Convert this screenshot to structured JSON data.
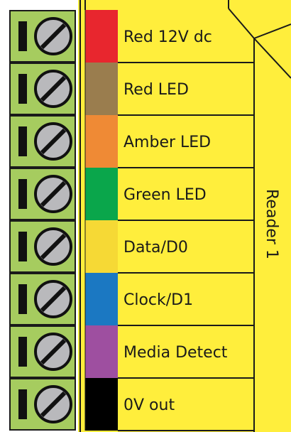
{
  "board": {
    "color": "#ffee3c",
    "terminal_color": "#a6cc5f",
    "reader_label": "Reader 1"
  },
  "wires": [
    {
      "label": "Red 12V dc",
      "color": "#e8262e"
    },
    {
      "label": "Red LED",
      "color": "#9a7d4e"
    },
    {
      "label": "Amber LED",
      "color": "#ef8a35"
    },
    {
      "label": "Green LED",
      "color": "#0aa64b"
    },
    {
      "label": "Data/D0",
      "color": "#f6d935"
    },
    {
      "label": "Clock/D1",
      "color": "#1b78c2"
    },
    {
      "label": "Media Detect",
      "color": "#9e4fa0"
    },
    {
      "label": "0V out",
      "color": "#000000"
    }
  ]
}
